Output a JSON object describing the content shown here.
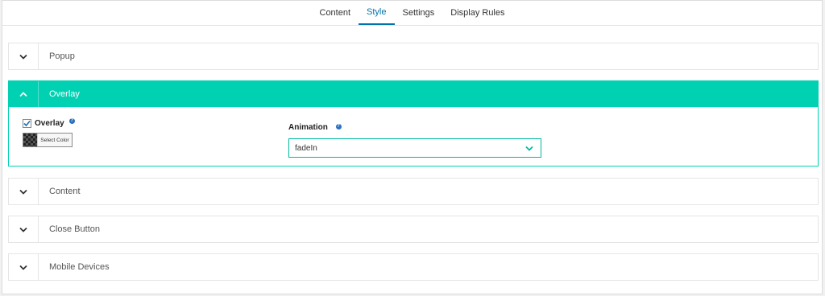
{
  "tabs": [
    {
      "label": "Content",
      "active": false
    },
    {
      "label": "Style",
      "active": true
    },
    {
      "label": "Settings",
      "active": false
    },
    {
      "label": "Display Rules",
      "active": false
    }
  ],
  "panels": {
    "popup": {
      "title": "Popup",
      "open": false
    },
    "overlay": {
      "title": "Overlay",
      "open": true,
      "overlay_field": {
        "label": "Overlay",
        "checked": true,
        "help": "?",
        "color_button": "Select Color"
      },
      "animation_field": {
        "label": "Animation",
        "help": "?",
        "value": "fadeIn"
      }
    },
    "content": {
      "title": "Content",
      "open": false
    },
    "close_button": {
      "title": "Close Button",
      "open": false
    },
    "mobile_devices": {
      "title": "Mobile Devices",
      "open": false
    }
  },
  "colors": {
    "accent": "#00d1b2",
    "link": "#0073aa"
  },
  "icons": {
    "collapsed": "chevron-down-icon",
    "expanded": "chevron-up-icon",
    "checkbox": "checkmark-icon"
  }
}
